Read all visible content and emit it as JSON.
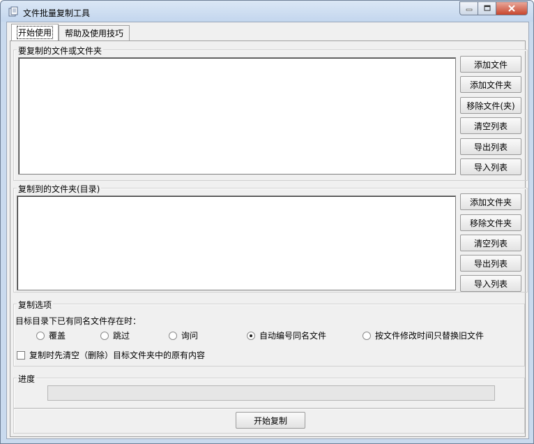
{
  "window": {
    "title": "文件批量复制工具"
  },
  "tabs": [
    {
      "label": "开始使用",
      "active": true
    },
    {
      "label": "帮助及使用技巧",
      "active": false
    }
  ],
  "source_group": {
    "label": "要复制的文件或文件夹",
    "buttons": [
      "添加文件",
      "添加文件夹",
      "移除文件(夹)",
      "清空列表",
      "导出列表",
      "导入列表"
    ]
  },
  "dest_group": {
    "label": "复制到的文件夹(目录)",
    "buttons": [
      "添加文件夹",
      "移除文件夹",
      "清空列表",
      "导出列表",
      "导入列表"
    ]
  },
  "options": {
    "label": "复制选项",
    "prompt": "目标目录下已有同名文件存在时：",
    "radios": [
      {
        "label": "覆盖",
        "checked": false
      },
      {
        "label": "跳过",
        "checked": false
      },
      {
        "label": "询问",
        "checked": false
      },
      {
        "label": "自动编号同名文件",
        "checked": true
      },
      {
        "label": "按文件修改时间只替换旧文件",
        "checked": false
      }
    ],
    "clear_first_label": "复制时先清空（删除）目标文件夹中的原有内容",
    "clear_first_checked": false
  },
  "progress": {
    "label": "进度",
    "value": 0
  },
  "start_button": "开始复制"
}
